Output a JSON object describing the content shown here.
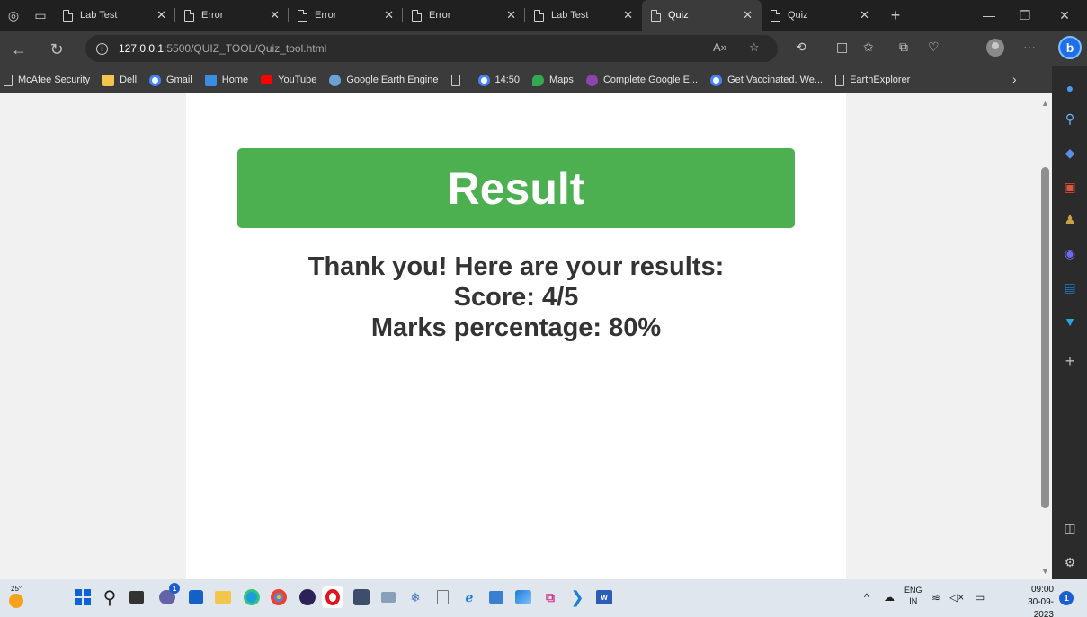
{
  "tabs": [
    {
      "label": "Lab Test",
      "active": false
    },
    {
      "label": "Error",
      "active": false
    },
    {
      "label": "Error",
      "active": false
    },
    {
      "label": "Error",
      "active": false
    },
    {
      "label": "Lab Test",
      "active": false
    },
    {
      "label": "Quiz",
      "active": true
    },
    {
      "label": "Quiz",
      "active": false
    }
  ],
  "address": {
    "host": "127.0.0.1",
    "path": ":5500/QUIZ_TOOL/Quiz_tool.html"
  },
  "bookmarks": [
    {
      "label": "McAfee Security",
      "icon": "page-icon"
    },
    {
      "label": "Dell",
      "icon": "folder-icon"
    },
    {
      "label": "Gmail",
      "icon": "google-icon"
    },
    {
      "label": "Home",
      "icon": "home-icon"
    },
    {
      "label": "YouTube",
      "icon": "youtube-icon"
    },
    {
      "label": "Google Earth Engine",
      "icon": "earth-engine-icon"
    },
    {
      "label": "",
      "icon": "page-icon"
    },
    {
      "label": "14:50",
      "icon": "google-icon"
    },
    {
      "label": "Maps",
      "icon": "maps-icon"
    },
    {
      "label": "Complete Google E...",
      "icon": "course-icon"
    },
    {
      "label": "Get Vaccinated. We...",
      "icon": "google-icon"
    },
    {
      "label": "EarthExplorer",
      "icon": "page-icon"
    }
  ],
  "page": {
    "result_title": "Result",
    "thanks": "Thank you! Here are your results:",
    "score": "Score: 4/5",
    "percentage": "Marks percentage: 80%"
  },
  "taskbar": {
    "temperature": "25°",
    "language": "ENG",
    "region": "IN",
    "time": "09:00",
    "date": "30-09-2023",
    "notification_count": "1",
    "teams_badge": "1"
  },
  "colors": {
    "result_banner": "#4caf50",
    "page_text": "#333333",
    "browser_chrome": "#3b3b3b",
    "taskbar": "#dfe6ee"
  }
}
